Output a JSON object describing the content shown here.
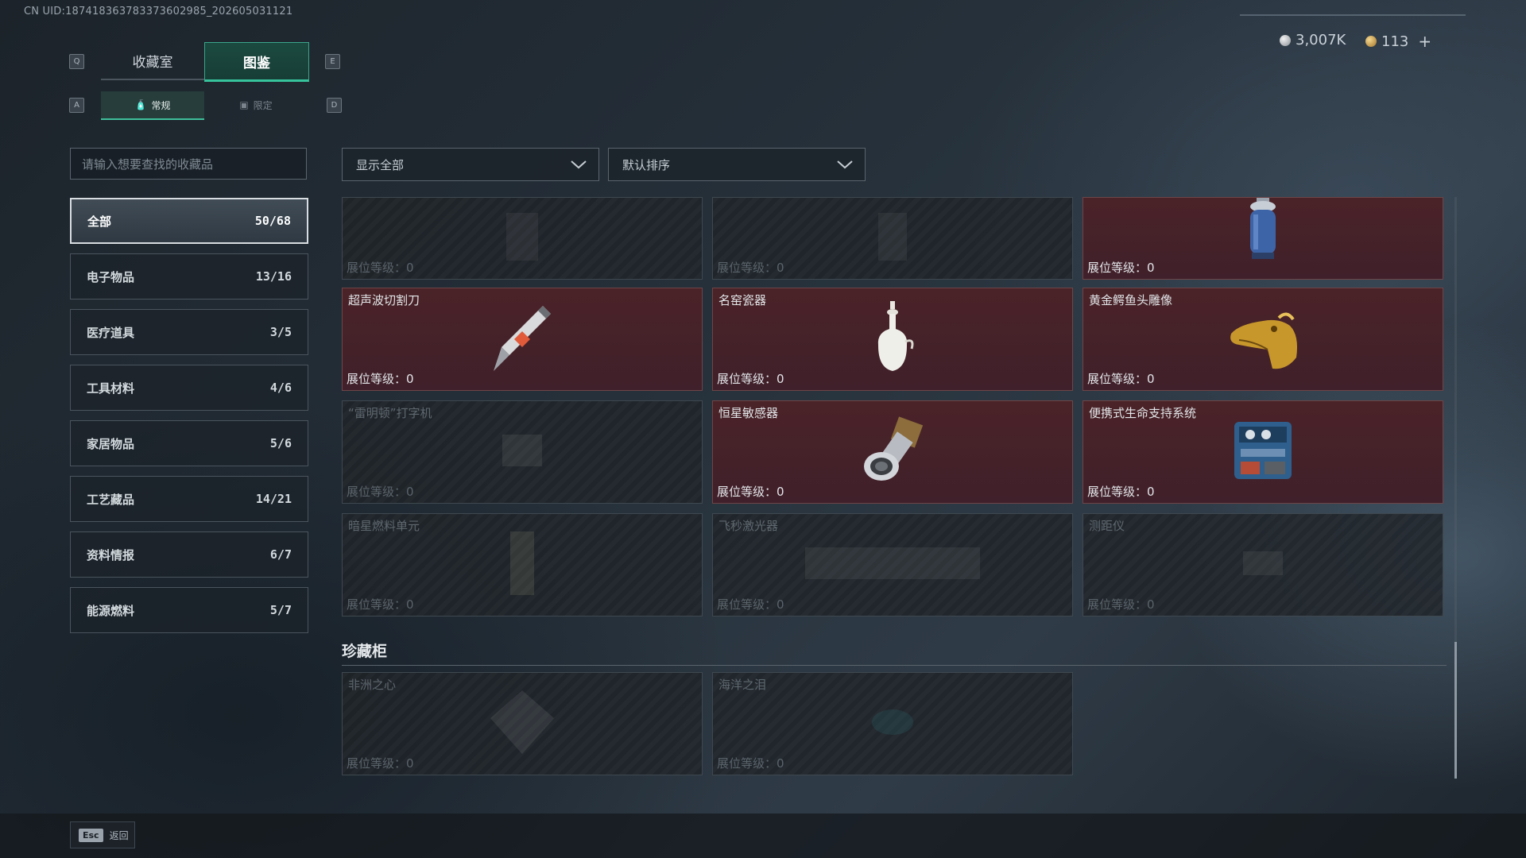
{
  "uid": "CN UID:18741836378337360298​5_202605031121",
  "currency": {
    "silver": "3,007K",
    "gold": "113",
    "plus": "+"
  },
  "keys": {
    "q": "Q",
    "e": "E",
    "a": "A",
    "d": "D"
  },
  "main_tabs": [
    {
      "label": "收藏室"
    },
    {
      "label": "图鉴"
    }
  ],
  "sub_tabs": [
    {
      "label": "常规",
      "icon": "bottle-icon"
    },
    {
      "label": "限定",
      "icon": "image-icon"
    }
  ],
  "search": {
    "placeholder": "请输入想要查找的收藏品"
  },
  "categories": [
    {
      "label": "全部",
      "count": "50/68"
    },
    {
      "label": "电子物品",
      "count": "13/16"
    },
    {
      "label": "医疗道具",
      "count": "3/5"
    },
    {
      "label": "工具材料",
      "count": "4/6"
    },
    {
      "label": "家居物品",
      "count": "5/6"
    },
    {
      "label": "工艺藏品",
      "count": "14/21"
    },
    {
      "label": "资料情报",
      "count": "6/7"
    },
    {
      "label": "能源燃料",
      "count": "5/7"
    }
  ],
  "filters": {
    "show": "显示全部",
    "sort": "默认排序"
  },
  "items": [
    {
      "name": "",
      "level": "展位等级：0",
      "owned": false,
      "icon": "machine-icon"
    },
    {
      "name": "",
      "level": "展位等级：0",
      "owned": false,
      "icon": "cabinet-icon"
    },
    {
      "name": "",
      "level": "展位等级：0",
      "owned": true,
      "icon": "gas-canister-icon"
    },
    {
      "name": "超声波切割刀",
      "level": "展位等级：0",
      "owned": true,
      "icon": "ultrasonic-knife-icon"
    },
    {
      "name": "名窑瓷器",
      "level": "展位等级：0",
      "owned": true,
      "icon": "porcelain-vase-icon"
    },
    {
      "name": "黄金鳄鱼头雕像",
      "level": "展位等级：0",
      "owned": true,
      "icon": "gold-crocodile-icon"
    },
    {
      "name": "“雷明顿”打字机",
      "level": "展位等级：0",
      "owned": false,
      "icon": "typewriter-icon"
    },
    {
      "name": "恒星敏感器",
      "level": "展位等级：0",
      "owned": true,
      "icon": "star-sensor-icon"
    },
    {
      "name": "便携式生命支持系统",
      "level": "展位等级：0",
      "owned": true,
      "icon": "life-support-icon"
    },
    {
      "name": "暗星燃料单元",
      "level": "展位等级：0",
      "owned": false,
      "icon": "fuel-cell-icon"
    },
    {
      "name": "飞秒激光器",
      "level": "展位等级：0",
      "owned": false,
      "icon": "laser-icon"
    },
    {
      "name": "测距仪",
      "level": "展位等级：0",
      "owned": false,
      "icon": "rangefinder-icon"
    }
  ],
  "vault": {
    "title": "珍藏柜",
    "items": [
      {
        "name": "非洲之心",
        "level": "展位等级：0",
        "owned": false,
        "icon": "diamond-icon"
      },
      {
        "name": "海洋之泪",
        "level": "展位等级：0",
        "owned": false,
        "icon": "gem-icon"
      }
    ]
  },
  "footer": {
    "esc_key": "Esc",
    "esc_label": "返回"
  }
}
